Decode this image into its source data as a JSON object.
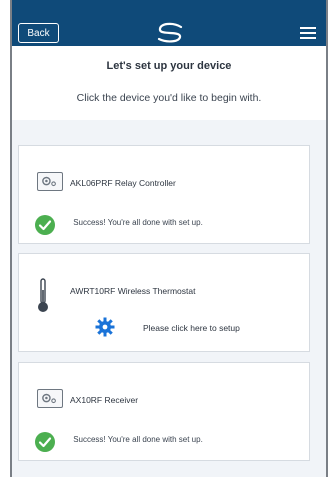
{
  "topbar": {
    "back_label": "Back"
  },
  "header": {
    "title": "Let's set up your device",
    "subtitle": "Click the device you'd like to begin with."
  },
  "devices": [
    {
      "name": "AKL06PRF Relay Controller",
      "status": "Success! You're all done with set up.",
      "icon": "relay-icon"
    },
    {
      "name": "AWRT10RF Wireless Thermostat",
      "action": "Please click here to setup",
      "icon": "thermometer-icon"
    },
    {
      "name": "AX10RF Receiver",
      "status": "Success! You're all done with set up.",
      "icon": "receiver-icon"
    }
  ],
  "colors": {
    "topbar": "#0f4a79",
    "success": "#4caf50",
    "setup_gear": "#1a73d8"
  }
}
